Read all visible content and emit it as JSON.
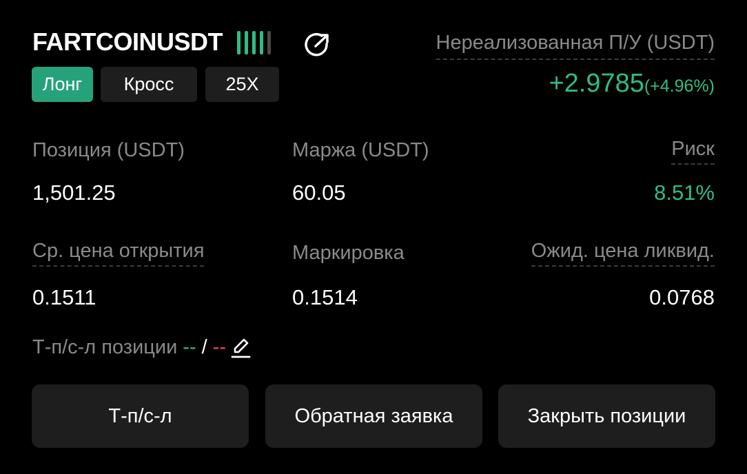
{
  "position": {
    "symbol": "FARTCOINUSDT",
    "signal_icon": "signal-bars-icon",
    "share_icon": "share-icon",
    "tags": {
      "side": "Лонг",
      "margin_mode": "Кросс",
      "leverage": "25X"
    },
    "colors": {
      "positive": "#2ebd85",
      "negative": "#f6465d",
      "long_tag": "#26a27a"
    }
  },
  "pnl": {
    "label": "Нереализованная П/У (USDT)",
    "value": "+2.9785",
    "percent": "(+4.96%)"
  },
  "stats": {
    "size_label": "Позиция (USDT)",
    "size_value": "1,501.25",
    "margin_label": "Маржа (USDT)",
    "margin_value": "60.05",
    "risk_label": "Риск",
    "risk_value": "8.51%",
    "entry_label": "Ср. цена открытия",
    "entry_value": "0.1511",
    "mark_label": "Маркировка",
    "mark_value": "0.1514",
    "liq_label": "Ожид. цена ликвид.",
    "liq_value": "0.0768"
  },
  "tpsl": {
    "label": "Т-п/с-л позиции",
    "tp": "--",
    "separator": "/",
    "sl": "--",
    "edit_icon": "edit-pencil-icon"
  },
  "buttons": {
    "tpsl": "Т-п/с-л",
    "reverse": "Обратная заявка",
    "close": "Закрыть позиции"
  }
}
